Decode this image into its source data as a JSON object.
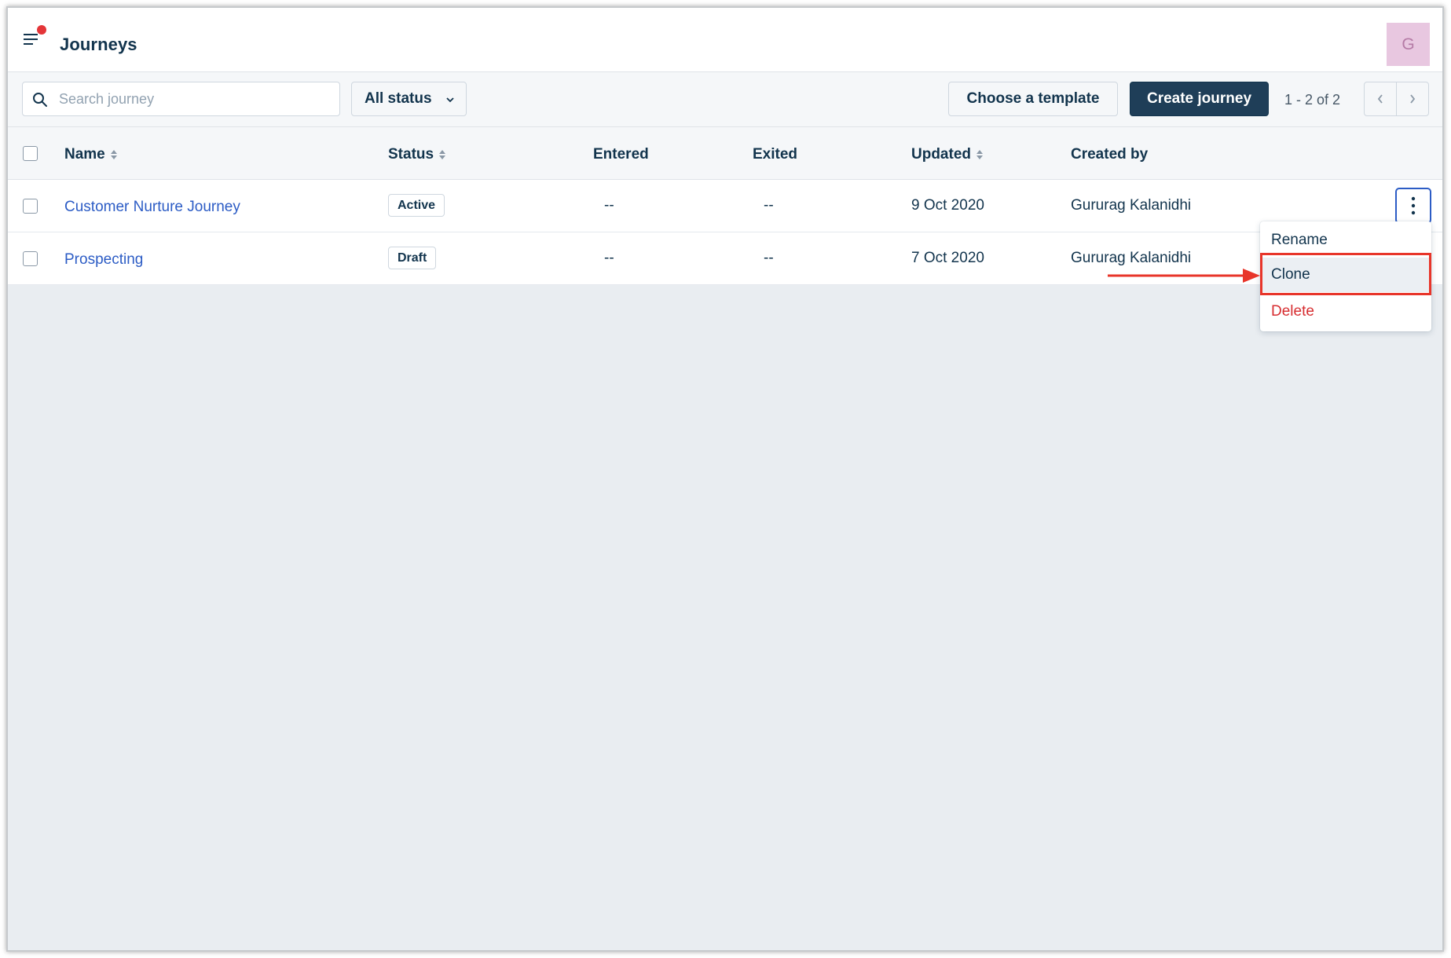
{
  "header": {
    "title": "Journeys",
    "avatar_initial": "G"
  },
  "toolbar": {
    "search_placeholder": "Search journey",
    "status_filter": "All status",
    "template_button": "Choose a template",
    "create_button": "Create journey",
    "pagination": "1 - 2 of 2"
  },
  "table": {
    "columns": {
      "name": "Name",
      "status": "Status",
      "entered": "Entered",
      "exited": "Exited",
      "updated": "Updated",
      "created_by": "Created by"
    },
    "rows": [
      {
        "name": "Customer Nurture Journey",
        "status": "Active",
        "entered": "--",
        "exited": "--",
        "updated": "9 Oct 2020",
        "created_by": "Gururag Kalanidhi"
      },
      {
        "name": "Prospecting",
        "status": "Draft",
        "entered": "--",
        "exited": "--",
        "updated": "7 Oct 2020",
        "created_by": "Gururag Kalanidhi"
      }
    ]
  },
  "row_menu": {
    "items": [
      "Rename",
      "Clone",
      "Delete"
    ],
    "highlighted": "Clone"
  },
  "colors": {
    "primary": "#1f3e58",
    "link": "#2c5cc5",
    "danger": "#d72d30",
    "annotation": "#e8352a",
    "notification": "#e43538"
  }
}
